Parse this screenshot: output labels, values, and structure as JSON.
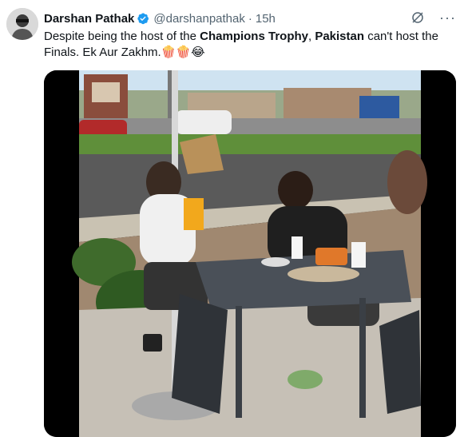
{
  "tweet": {
    "author_name": "Darshan Pathak",
    "handle": "@darshanpathak",
    "separator": "·",
    "time": "15h",
    "text_parts": [
      {
        "text": "Despite being the host of the ",
        "bold": false
      },
      {
        "text": "Champions Trophy",
        "bold": true
      },
      {
        "text": ", ",
        "bold": false
      },
      {
        "text": "Pakistan",
        "bold": true
      },
      {
        "text": " can't host the Finals. Ek Aur Zakhm.",
        "bold": false
      },
      {
        "text": "🍿🍿😂",
        "bold": false
      }
    ],
    "icons": {
      "avatar": "author-avatar",
      "verified": "verified-badge-icon",
      "grok": "grok-icon",
      "more": "more-options-icon"
    },
    "more_glyph": "···",
    "colors": {
      "verified_blue": "#1d9bf0",
      "secondary_text": "#536471",
      "primary_text": "#0f1419"
    }
  }
}
